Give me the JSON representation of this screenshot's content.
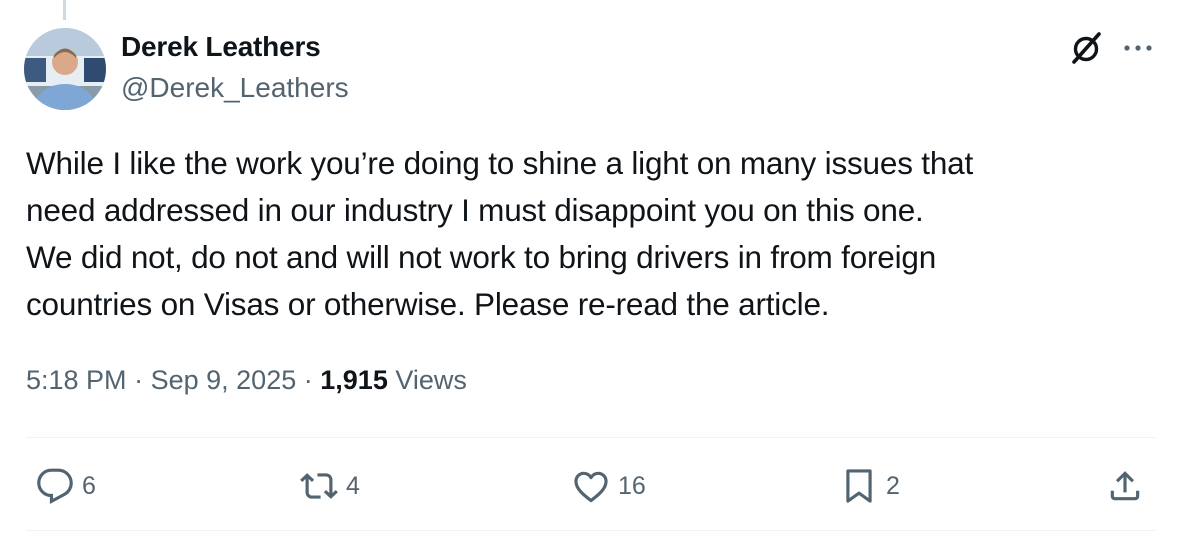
{
  "author": {
    "display_name": "Derek Leathers",
    "handle": "@Derek_Leathers"
  },
  "tweet": {
    "text": "While I like the work you’re doing to shine a light on many issues that\nneed addressed in our industry I must disappoint you on this one.\nWe did not, do not and will not work to bring drivers in from foreign\ncountries on Visas or otherwise. Please re-read the article.",
    "time": "5:18 PM",
    "separator": "·",
    "date": "Sep 9, 2025",
    "views_count": "1,915",
    "views_label": "Views"
  },
  "actions": {
    "replies": "6",
    "reposts": "4",
    "likes": "16",
    "bookmarks": "2"
  },
  "icons": [
    "grok-icon",
    "more-icon",
    "reply-icon",
    "repost-icon",
    "like-icon",
    "bookmark-icon",
    "share-icon"
  ],
  "colors": {
    "text": "#0f1419",
    "secondary": "#536471",
    "divider": "#eff3f4"
  }
}
